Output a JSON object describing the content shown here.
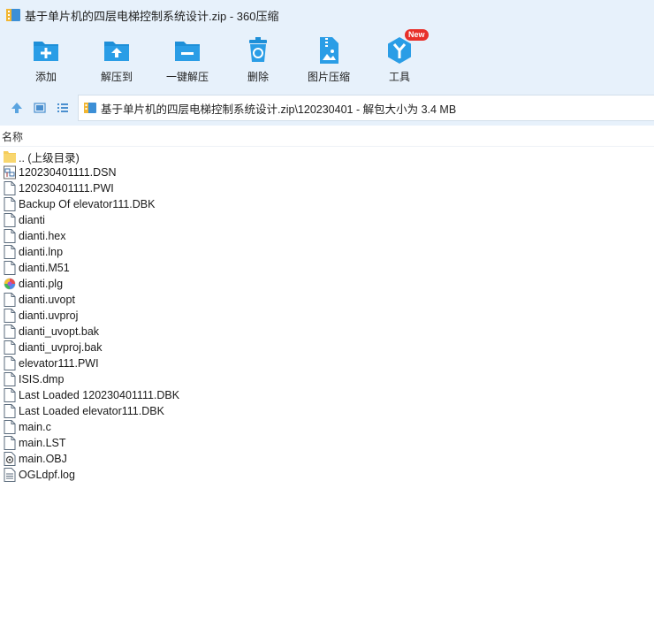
{
  "window": {
    "title": "基于单片机的四层电梯控制系统设计.zip - 360压缩"
  },
  "toolbar": {
    "items": [
      {
        "label": "添加",
        "icon": "add-icon"
      },
      {
        "label": "解压到",
        "icon": "extract-to-icon"
      },
      {
        "label": "一键解压",
        "icon": "one-click-extract-icon"
      },
      {
        "label": "删除",
        "icon": "delete-icon"
      },
      {
        "label": "图片压缩",
        "icon": "image-compress-icon"
      },
      {
        "label": "工具",
        "icon": "tools-icon",
        "badge": "New"
      }
    ]
  },
  "address": {
    "path": "基于单片机的四层电梯控制系统设计.zip\\120230401 - 解包大小为 3.4 MB"
  },
  "columns": {
    "name": "名称"
  },
  "files": [
    {
      "name": ".. (上级目录)",
      "icon": "folder-icon"
    },
    {
      "name": "120230401111.DSN",
      "icon": "dsn-file-icon"
    },
    {
      "name": "120230401111.PWI",
      "icon": "file-icon"
    },
    {
      "name": "Backup Of elevator111.DBK",
      "icon": "file-icon"
    },
    {
      "name": "dianti",
      "icon": "file-icon"
    },
    {
      "name": "dianti.hex",
      "icon": "file-icon"
    },
    {
      "name": "dianti.lnp",
      "icon": "file-icon"
    },
    {
      "name": "dianti.M51",
      "icon": "file-icon"
    },
    {
      "name": "dianti.plg",
      "icon": "plg-file-icon"
    },
    {
      "name": "dianti.uvopt",
      "icon": "file-icon"
    },
    {
      "name": "dianti.uvproj",
      "icon": "file-icon"
    },
    {
      "name": "dianti_uvopt.bak",
      "icon": "file-icon"
    },
    {
      "name": "dianti_uvproj.bak",
      "icon": "file-icon"
    },
    {
      "name": "elevator111.PWI",
      "icon": "file-icon"
    },
    {
      "name": "ISIS.dmp",
      "icon": "file-icon"
    },
    {
      "name": "Last Loaded 120230401111.DBK",
      "icon": "file-icon"
    },
    {
      "name": "Last Loaded elevator111.DBK",
      "icon": "file-icon"
    },
    {
      "name": "main.c",
      "icon": "file-icon"
    },
    {
      "name": "main.LST",
      "icon": "file-icon"
    },
    {
      "name": "main.OBJ",
      "icon": "obj-file-icon"
    },
    {
      "name": "OGLdpf.log",
      "icon": "text-file-icon"
    }
  ],
  "colors": {
    "toolbar_bg": "#e7f1fb",
    "icon_blue": "#1e8fd8",
    "badge_red": "#e8302a",
    "folder_yellow": "#f5cc5a"
  }
}
